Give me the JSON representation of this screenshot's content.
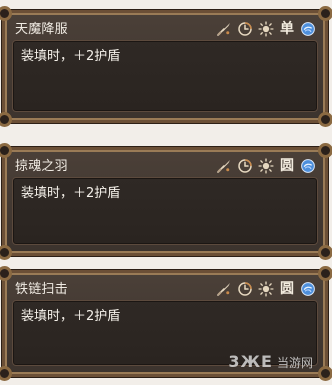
{
  "cards": [
    {
      "title": "天魔降服",
      "mode_label": "单",
      "description": "装填时，＋2护盾"
    },
    {
      "title": "掠魂之羽",
      "mode_label": "圆",
      "description": "装填时，＋2护盾"
    },
    {
      "title": "铁链扫击",
      "mode_label": "圆",
      "description": "装填时，＋2护盾"
    }
  ],
  "watermark": {
    "brand": "3ЖE",
    "suffix": "当游网"
  },
  "colors": {
    "card_border": "#6b4f36",
    "card_bg": "#3c332d",
    "desc_bg": "#2a2420",
    "text": "#f0ebe3",
    "icon": "#e5d7bf",
    "orb": "#4d8fdc"
  },
  "icons": {
    "weapon": "sword-icon",
    "time": "clock-icon",
    "weather": "sun-icon",
    "mode": "mode-badge",
    "orb": "blue-orb-icon"
  }
}
